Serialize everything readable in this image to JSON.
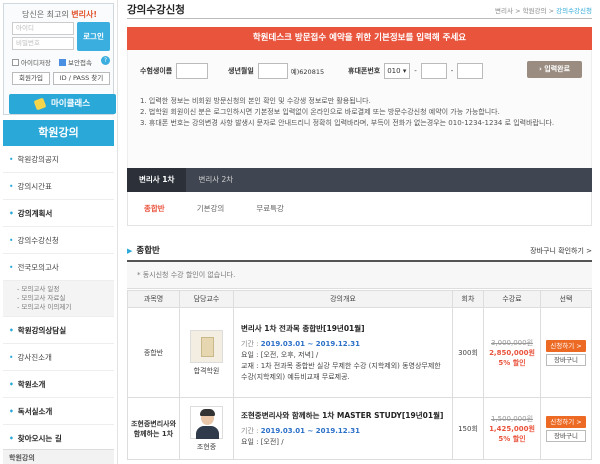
{
  "sidebar": {
    "login_title_pre": "당신은 최고의",
    "login_title_hl": "변리사!",
    "id_placeholder": "아이디",
    "pw_placeholder": "비밀번호",
    "login_btn": "로그인",
    "chk_id_save": "아이디저장",
    "chk_secure": "보안접속",
    "help": "?",
    "join_btn": "회원가입",
    "find_btn": "ID / PASS 찾기",
    "myclass": "마이클래스",
    "section_title": "학원강의",
    "menu": [
      {
        "label": "학원강의공지"
      },
      {
        "label": "강의시간표"
      },
      {
        "label": "강의계획서"
      },
      {
        "label": "강의수강신청"
      },
      {
        "label": "전국모의고사"
      }
    ],
    "submenu": [
      "- 모의고사 일정",
      "- 모의고사 자료실",
      "- 모의고사 이의제기"
    ],
    "menu2": [
      {
        "label": "학원강의상담실"
      },
      {
        "label": "강사진소개"
      },
      {
        "label": "학원소개"
      },
      {
        "label": "독서실소개"
      },
      {
        "label": "찾아오시는 길"
      }
    ],
    "footer": "학원강의"
  },
  "main": {
    "title": "강의수강신청",
    "breadcrumb": {
      "c1": "변리사",
      "c2": "학원강의",
      "c3": "강의수강신청"
    },
    "notice": "학원데스크 방문접수 예약을 위한 기본정보를 입력해 주세요",
    "form": {
      "name_label": "수험생이름",
      "birth_label": "생년월일",
      "birth_hint": "예)620815",
      "phone_label": "휴대폰번호",
      "phone_prefix": "010",
      "dash": "-",
      "submit": "입력완료"
    },
    "info": [
      "1. 입력한 정보는 비회원 방문신청의 본인 확인 및 수강생 정보로만 활용됩니다.",
      "2. 법학원 회원이신 분은 로그인하시면 기본정보 입력없이 온라인으로 바로결제 또는 방문수강신청 예약이 가능 가능합니다.",
      "3. 휴대폰 번호는 강의변경 사항 발생시 문자로 안내드리니 정확히 입력바라며, 부득이 전화가 없는경우는 010-1234-1234 로 입력바랍니다."
    ],
    "dark_tabs": [
      "변리사 1차",
      "변리사 2차"
    ],
    "sub_tabs": [
      "종합반",
      "기본강의",
      "무료특강"
    ],
    "section_title": "종합반",
    "cart_link": "장바구니 확인하기 >",
    "empty_note": "* 동시신청 수강 할인이 없습니다.",
    "table": {
      "headers": [
        "과목명",
        "담당교수",
        "강의개요",
        "회차",
        "수강료",
        "선택"
      ],
      "rows": [
        {
          "subject": "종합반",
          "prof": "합격학원",
          "title": "변리사 1차 전과목 종합반[19년01월]",
          "period_label": "기간 : ",
          "period": "2019.03.01 ~ 2019.12.31",
          "days": "요일 : [오전, 오후, 저녁] /",
          "material": "교재 : 1차 전과목 종합반 실강 무제한 수강 (지학제외) 동영상무제한수강(지학제외) 예듀비교재 무료제공.",
          "count": "300회",
          "old_price": "3,000,000원",
          "new_price": "2,850,000원",
          "disc": "5% 할인",
          "apply": "신청하기 >",
          "cart": "장바구니"
        },
        {
          "subject": "조현중변리사와 함께하는 1차",
          "prof": "조현중",
          "title": "조현중변리사와 함께하는 1차 MASTER STUDY[19년01월]",
          "period_label": "기간 : ",
          "period": "2019.03.01 ~ 2019.12.31",
          "days": "요일 : [오전] /",
          "material": "",
          "count": "150회",
          "old_price": "1,500,000원",
          "new_price": "1,425,000원",
          "disc": "5% 할인",
          "apply": "신청하기 >",
          "cart": "장바구니"
        }
      ]
    }
  }
}
